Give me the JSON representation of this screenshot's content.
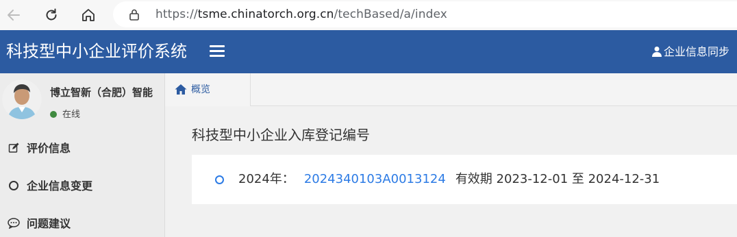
{
  "browser": {
    "url_scheme": "https://",
    "url_host": "tsme.chinatorch.org.cn",
    "url_path": "/techBased/a/index"
  },
  "header": {
    "title": "科技型中小企业评价系统",
    "user_sync_label": "企业信息同步"
  },
  "sidebar": {
    "company_name": "博立智新（合肥）智能",
    "status": "在线",
    "items": [
      {
        "label": "评价信息",
        "icon": "edit-icon"
      },
      {
        "label": "企业信息变更",
        "icon": "circle-icon"
      },
      {
        "label": "问题建议",
        "icon": "comment-icon"
      }
    ]
  },
  "tabs": [
    {
      "label": "概览",
      "icon": "home-icon"
    }
  ],
  "main": {
    "section_title": "科技型中小企业入库登记编号",
    "record": {
      "year_label": "2024年：",
      "number": "2024340103A0013124",
      "validity_text": "有效期 2023-12-01 至 2024-12-31"
    }
  },
  "colors": {
    "header_bg": "#2c5ba1",
    "link": "#2c7be5",
    "online": "#3f8a3f"
  }
}
